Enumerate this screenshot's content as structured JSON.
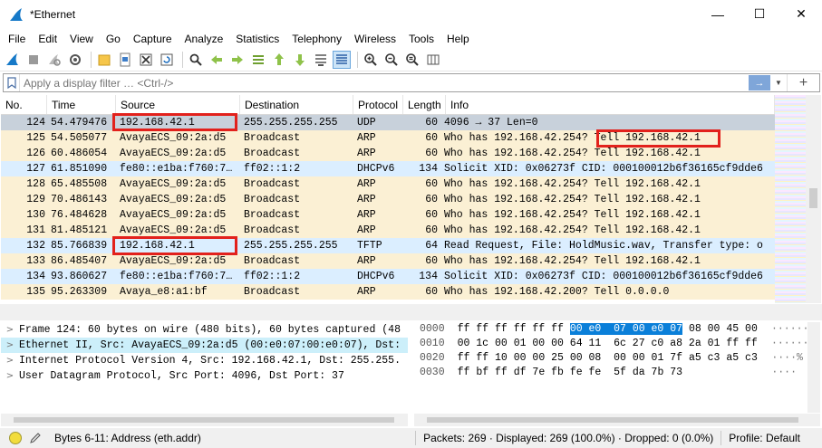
{
  "window": {
    "title": "*Ethernet",
    "minimize": "—",
    "maximize": "☐",
    "close": "✕"
  },
  "menu": [
    {
      "label": "File"
    },
    {
      "label": "Edit"
    },
    {
      "label": "View"
    },
    {
      "label": "Go"
    },
    {
      "label": "Capture"
    },
    {
      "label": "Analyze"
    },
    {
      "label": "Statistics"
    },
    {
      "label": "Telephony"
    },
    {
      "label": "Wireless"
    },
    {
      "label": "Tools"
    },
    {
      "label": "Help"
    }
  ],
  "filter": {
    "placeholder": "Apply a display filter … <Ctrl-/>",
    "apply_icon": "→",
    "dropdown_icon": "▼",
    "expression_icon": "+"
  },
  "packet_list": {
    "columns": [
      "No.",
      "Time",
      "Source",
      "Destination",
      "Protocol",
      "Length",
      "Info"
    ],
    "rows": [
      {
        "no": "124",
        "time": "54.479476",
        "src": "192.168.42.1",
        "dst": "255.255.255.255",
        "proto": "UDP",
        "len": "60",
        "info": "4096 → 37 Len=0",
        "bg": "#c8d1db",
        "selected": true
      },
      {
        "no": "125",
        "time": "54.505077",
        "src": "AvayaECS_09:2a:d5",
        "dst": "Broadcast",
        "proto": "ARP",
        "len": "60",
        "info": "Who has 192.168.42.254? Tell 192.168.42.1",
        "bg": "#fbf0d4"
      },
      {
        "no": "126",
        "time": "60.486054",
        "src": "AvayaECS_09:2a:d5",
        "dst": "Broadcast",
        "proto": "ARP",
        "len": "60",
        "info": "Who has 192.168.42.254? Tell 192.168.42.1",
        "bg": "#fbf0d4"
      },
      {
        "no": "127",
        "time": "61.851090",
        "src": "fe80::e1ba:f760:7…",
        "dst": "ff02::1:2",
        "proto": "DHCPv6",
        "len": "134",
        "info": "Solicit XID: 0x06273f CID: 000100012b6f36165cf9dde6",
        "bg": "#dbeeff"
      },
      {
        "no": "128",
        "time": "65.485508",
        "src": "AvayaECS_09:2a:d5",
        "dst": "Broadcast",
        "proto": "ARP",
        "len": "60",
        "info": "Who has 192.168.42.254? Tell 192.168.42.1",
        "bg": "#fbf0d4"
      },
      {
        "no": "129",
        "time": "70.486143",
        "src": "AvayaECS_09:2a:d5",
        "dst": "Broadcast",
        "proto": "ARP",
        "len": "60",
        "info": "Who has 192.168.42.254? Tell 192.168.42.1",
        "bg": "#fbf0d4"
      },
      {
        "no": "130",
        "time": "76.484628",
        "src": "AvayaECS_09:2a:d5",
        "dst": "Broadcast",
        "proto": "ARP",
        "len": "60",
        "info": "Who has 192.168.42.254? Tell 192.168.42.1",
        "bg": "#fbf0d4"
      },
      {
        "no": "131",
        "time": "81.485121",
        "src": "AvayaECS_09:2a:d5",
        "dst": "Broadcast",
        "proto": "ARP",
        "len": "60",
        "info": "Who has 192.168.42.254? Tell 192.168.42.1",
        "bg": "#fbf0d4"
      },
      {
        "no": "132",
        "time": "85.766839",
        "src": "192.168.42.1",
        "dst": "255.255.255.255",
        "proto": "TFTP",
        "len": "64",
        "info": "Read Request, File: HoldMusic.wav, Transfer type: o",
        "bg": "#dbeeff"
      },
      {
        "no": "133",
        "time": "86.485407",
        "src": "AvayaECS_09:2a:d5",
        "dst": "Broadcast",
        "proto": "ARP",
        "len": "60",
        "info": "Who has 192.168.42.254? Tell 192.168.42.1",
        "bg": "#fbf0d4"
      },
      {
        "no": "134",
        "time": "93.860627",
        "src": "fe80::e1ba:f760:7…",
        "dst": "ff02::1:2",
        "proto": "DHCPv6",
        "len": "134",
        "info": "Solicit XID: 0x06273f CID: 000100012b6f36165cf9dde6",
        "bg": "#dbeeff"
      },
      {
        "no": "135",
        "time": "95.263309",
        "src": "Avaya_e8:a1:bf",
        "dst": "Broadcast",
        "proto": "ARP",
        "len": "60",
        "info": "Who has 192.168.42.200? Tell 0.0.0.0",
        "bg": "#fbf0d4"
      }
    ]
  },
  "details": [
    {
      "arrow": ">",
      "text": "Frame 124: 60 bytes on wire (480 bits), 60 bytes captured (48",
      "bg": "#ffffff"
    },
    {
      "arrow": ">",
      "text": "Ethernet II, Src: AvayaECS_09:2a:d5 (00:e0:07:00:e0:07), Dst:",
      "bg": "#cceffa"
    },
    {
      "arrow": ">",
      "text": "Internet Protocol Version 4, Src: 192.168.42.1, Dst: 255.255.",
      "bg": "#ffffff"
    },
    {
      "arrow": ">",
      "text": "User Datagram Protocol, Src Port: 4096, Dst Port: 37",
      "bg": "#ffffff"
    }
  ],
  "bytes": [
    {
      "off": "0000",
      "pre": "ff ff ff ff ff ff ",
      "sel": "00 e0  07 00 e0 07",
      "post": " 08 00 45 00",
      "asc": "······"
    },
    {
      "off": "0010",
      "pre": "00 1c 00 01 00 00 64 11  6c 27 c0 a8 2a 01 ff ff",
      "sel": "",
      "post": "",
      "asc": "······"
    },
    {
      "off": "0020",
      "pre": "ff ff 10 00 00 25 00 08  00 00 01 7f a5 c3 a5 c3",
      "sel": "",
      "post": "",
      "asc": "····%"
    },
    {
      "off": "0030",
      "pre": "ff bf ff df 7e fb fe fe  5f da 7b 73",
      "sel": "",
      "post": "",
      "asc": "····"
    }
  ],
  "status": {
    "field": "Bytes 6-11: Address (eth.addr)",
    "packets": "Packets: 269 · Displayed: 269 (100.0%) · Dropped: 0 (0.0%)",
    "profile": "Profile: Default"
  },
  "colors": {
    "highlight_red": "#e2211c",
    "byte_selection": "#0a7fd9",
    "arp_row": "#fbf0d4",
    "udp_row": "#dbeeff"
  }
}
